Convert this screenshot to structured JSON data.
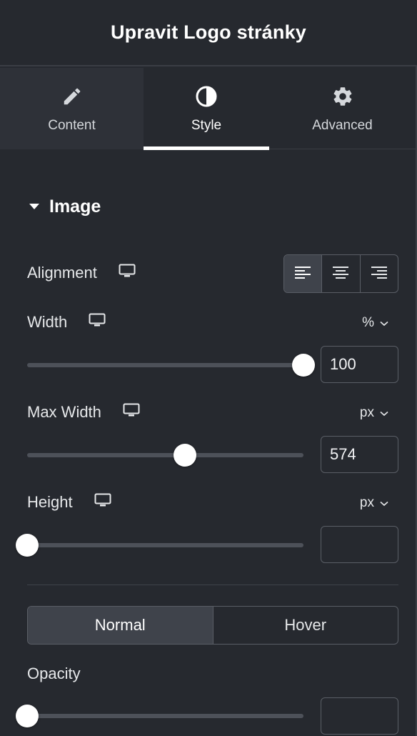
{
  "header": {
    "title": "Upravit Logo stránky"
  },
  "tabs": [
    {
      "label": "Content",
      "icon": "pencil-icon"
    },
    {
      "label": "Style",
      "icon": "contrast-icon",
      "active": true
    },
    {
      "label": "Advanced",
      "icon": "gear-icon"
    }
  ],
  "section": {
    "title": "Image",
    "expanded": true
  },
  "alignment": {
    "label": "Alignment",
    "device_icon": "desktop-icon",
    "options": [
      "align-left-icon",
      "align-center-icon",
      "align-right-icon"
    ],
    "selected": "left"
  },
  "width": {
    "label": "Width",
    "unit": "%",
    "value": "100",
    "slider_fraction": 1.0
  },
  "max_width": {
    "label": "Max Width",
    "unit": "px",
    "value": "574",
    "slider_fraction": 0.57
  },
  "height": {
    "label": "Height",
    "unit": "px",
    "value": "",
    "slider_fraction": 0.0
  },
  "state_toggle": {
    "options": [
      "Normal",
      "Hover"
    ],
    "selected": "Normal"
  },
  "opacity": {
    "label": "Opacity",
    "value": "",
    "slider_fraction": 0.0
  },
  "colors": {
    "panel_bg": "#26292f",
    "active_tab_bg": "#2e3138",
    "accent": "#ffffff",
    "border": "#5a5e66",
    "track": "#4d5159"
  }
}
